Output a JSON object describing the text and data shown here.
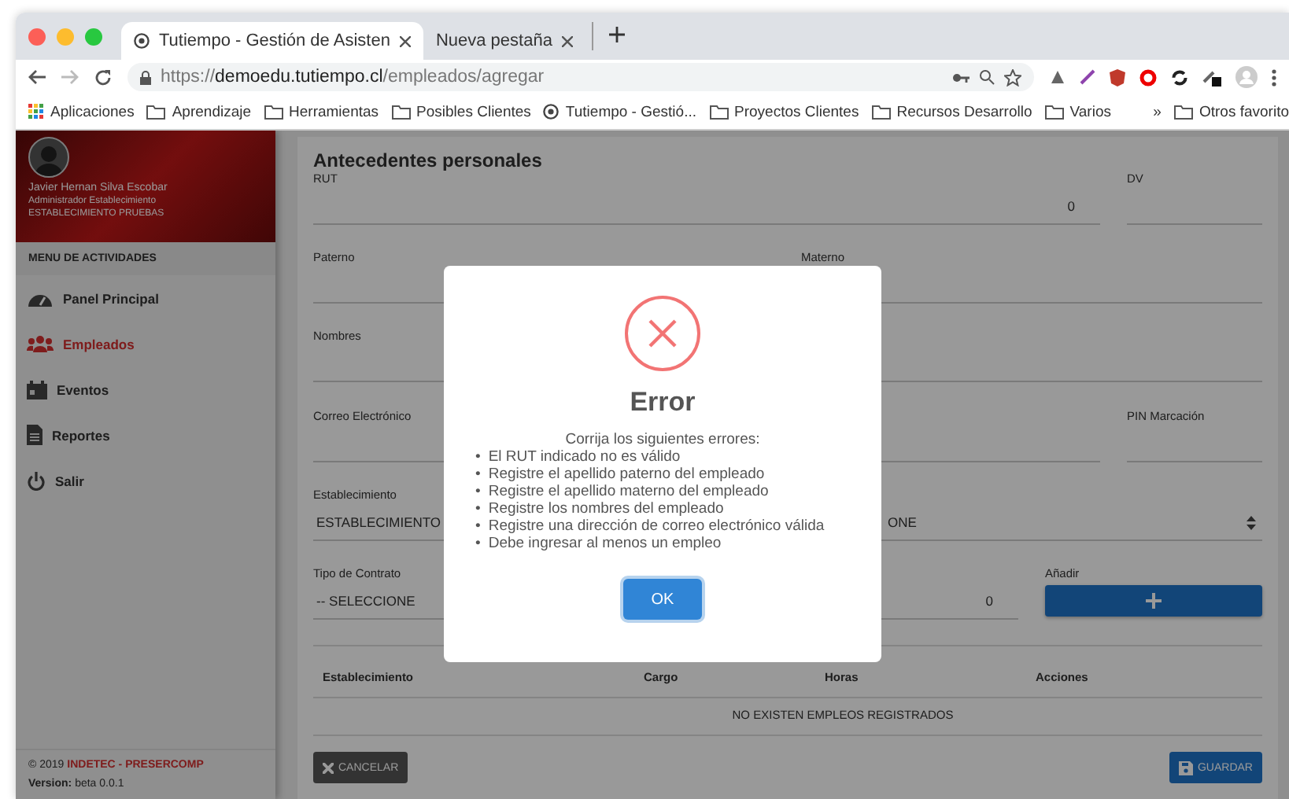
{
  "browser": {
    "tabs": [
      {
        "title": "Tutiempo - Gestión de Asisten",
        "selected": true
      },
      {
        "title": "Nueva pestaña",
        "selected": false
      }
    ],
    "url": {
      "scheme": "https://",
      "host": "demoedu.tutiempo.cl",
      "path": "/empleados/agregar"
    },
    "bookmarks": [
      {
        "label": "Aplicaciones",
        "kind": "apps"
      },
      {
        "label": "Aprendizaje",
        "kind": "folder"
      },
      {
        "label": "Herramientas",
        "kind": "folder"
      },
      {
        "label": "Posibles Clientes",
        "kind": "folder"
      },
      {
        "label": "Tutiempo - Gestió...",
        "kind": "site"
      },
      {
        "label": "Proyectos Clientes",
        "kind": "folder"
      },
      {
        "label": "Recursos Desarrollo",
        "kind": "folder"
      },
      {
        "label": "Varios",
        "kind": "folder"
      }
    ],
    "bookmarks_overflow": "»",
    "other_bookmarks": "Otros favorito"
  },
  "sidebar": {
    "user": {
      "name": "Javier Hernan Silva Escobar",
      "role": "Administrador Establecimiento",
      "establishment": "ESTABLECIMIENTO PRUEBAS"
    },
    "menu_title": "MENU DE ACTIVIDADES",
    "items": [
      {
        "label": "Panel Principal",
        "kind": "gauge",
        "selected": false
      },
      {
        "label": "Empleados",
        "kind": "users",
        "selected": true
      },
      {
        "label": "Eventos",
        "kind": "calendar",
        "selected": false
      },
      {
        "label": "Reportes",
        "kind": "document",
        "selected": false
      },
      {
        "label": "Salir",
        "kind": "power",
        "selected": false
      }
    ],
    "footer": {
      "copyright": "© 2019",
      "company": "INDETEC - PRESERCOMP",
      "version": "**Version:** beta 0.0.1"
    }
  },
  "form": {
    "title": "Antecedentes personales",
    "rows": [
      [
        {
          "label": "RUT",
          "kind": "number",
          "value": "0"
        },
        {
          "label": "DV",
          "kind": "text"
        }
      ],
      [
        {
          "label": "Paterno",
          "kind": "text"
        },
        {
          "label": "Materno",
          "kind": "text"
        }
      ],
      [
        {
          "label": "Nombres",
          "kind": "text"
        }
      ],
      [
        {
          "label": "Correo Electrónico",
          "kind": "text"
        },
        {
          "label": "PIN Marcación",
          "kind": "text"
        }
      ],
      [
        {
          "label": "Establecimiento",
          "kind": "text",
          "value": "ESTABLECIMIENTO"
        },
        {
          "kind": "select",
          "value": "ONE"
        }
      ],
      [
        {
          "label": "Tipo de Contrato",
          "kind": "text",
          "value": "-- SELECCIONE"
        },
        {
          "kind": "number",
          "value": "0"
        },
        {
          "label": "Añadir",
          "kind": "add"
        }
      ]
    ],
    "table": {
      "columns": [
        "Establecimiento",
        "Cargo",
        "Horas",
        "Acciones"
      ],
      "empty": "NO EXISTEN EMPLEOS REGISTRADOS"
    },
    "cancel": "CANCELAR",
    "save": "GUARDAR"
  },
  "modal": {
    "title": "Error",
    "message": "Corrija los siguientes errores:",
    "bullet": "•",
    "errors": [
      "El RUT indicado no es válido",
      "Registre el apellido paterno del empleado",
      "Registre el apellido materno del empleado",
      "Registre los nombres del empleado",
      "Registre una dirección de correo electrónico válida",
      "Debe ingresar al menos un empleo"
    ],
    "ok": "OK"
  }
}
